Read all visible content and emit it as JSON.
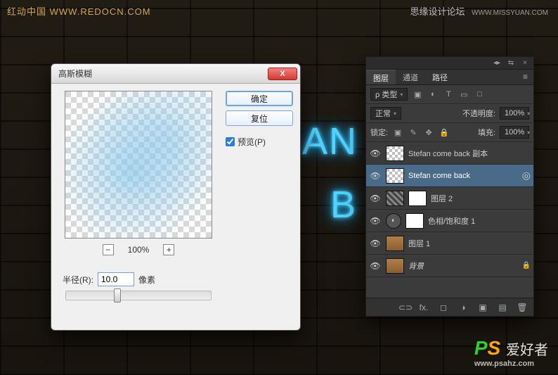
{
  "watermarks": {
    "top_left": "红动中国 WWW.REDOCN.COM",
    "top_right_cn": "思缘设计论坛",
    "top_right_url": "WWW.MISSYUAN.COM"
  },
  "neon": {
    "line1": "AN",
    "line2": "B"
  },
  "dialog": {
    "title": "高斯模糊",
    "ok": "确定",
    "reset": "复位",
    "preview_label": "预览(P)",
    "preview_checked": true,
    "zoom_pct": "100%",
    "radius_label": "半径(R):",
    "radius_value": "10.0",
    "radius_unit": "像素"
  },
  "panel": {
    "tabs": {
      "layers": "图层",
      "channels": "通道",
      "paths": "路径"
    },
    "filter": {
      "kind": "ρ 类型"
    },
    "blend": {
      "mode": "正常",
      "opacity_label": "不透明度:",
      "opacity_value": "100%"
    },
    "lock": {
      "label": "锁定:",
      "fill_label": "填充:",
      "fill_value": "100%"
    },
    "layers": [
      {
        "name": "Stefan  come back 副本",
        "thumb": "check"
      },
      {
        "name": "Stefan  come back",
        "thumb": "check",
        "selected": true,
        "smart": true
      },
      {
        "name": "图层 2",
        "thumb": "noise",
        "mask": true
      },
      {
        "name": "色相/饱和度 1",
        "thumb": "adj",
        "mask": true
      },
      {
        "name": "图层 1",
        "thumb": "tex"
      },
      {
        "name": "背景",
        "thumb": "tex",
        "locked": true,
        "italic": true
      }
    ],
    "footer_icons": [
      "link",
      "fx",
      "mask",
      "adj",
      "group",
      "new",
      "trash"
    ]
  },
  "bottom_logo": {
    "p": "P",
    "s": "S",
    "rest": "爱好者",
    "url": "www.psahz.com"
  },
  "glyphs": {
    "close_x": "X",
    "minus": "−",
    "plus": "+",
    "caret": "▾",
    "menu": "≡",
    "eye": "👁",
    "chain": "⛓",
    "lock": "🔒",
    "image": "▣",
    "adjust": "◐",
    "text": "T",
    "shape": "▭",
    "filter_icon_group": "□",
    "arrow_lr": "◂▸",
    "arrow_double": "⇆",
    "panel_x": "×",
    "fx": "fx.",
    "mask_icon": "◻",
    "adj_icon": "◑",
    "folder": "▣",
    "new": "▤",
    "trash": "🗑",
    "move": "✥",
    "brush": "✎",
    "link_icon": "⊂⊃",
    "smart": "◎"
  }
}
